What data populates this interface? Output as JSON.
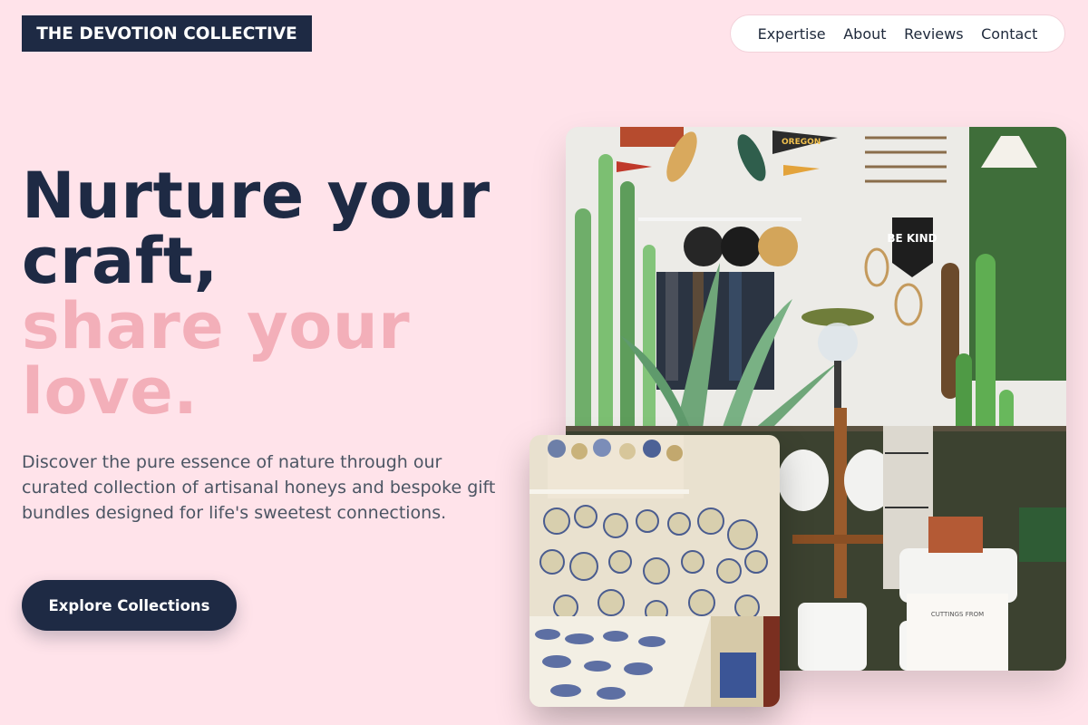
{
  "header": {
    "logo_text": "THE DEVOTION COLLECTIVE",
    "nav": [
      {
        "label": "Expertise"
      },
      {
        "label": "About"
      },
      {
        "label": "Reviews"
      },
      {
        "label": "Contact"
      }
    ]
  },
  "hero": {
    "headline_line1": "Nurture your",
    "headline_line2": "craft,",
    "headline_line3": "share your",
    "headline_line4": "love.",
    "description": "Discover the pure essence of nature through our curated collection of artisanal honeys and bespoke gift bundles designed for life's sweetest connections.",
    "cta_label": "Explore Collections"
  },
  "images": {
    "main_sign_text": "BE KIND",
    "main_pennant_text": "OREGON",
    "main_card_text": "CUTTINGS FROM"
  },
  "colors": {
    "background": "#ffe3ea",
    "navy": "#1e2a44",
    "pink_accent": "#f3afb9"
  }
}
